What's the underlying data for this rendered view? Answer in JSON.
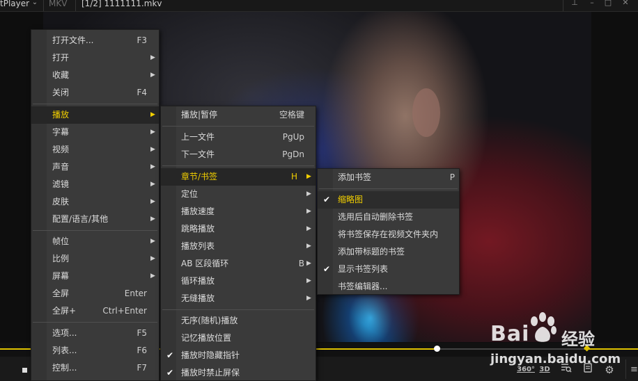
{
  "titlebar": {
    "app_name": "tPlayer",
    "format": "MKV",
    "file": "[1/2] 1111111.mkv"
  },
  "icons": {
    "app_menu": "chevron-down",
    "pin": "pin",
    "minimize": "minimize",
    "maximize": "maximize",
    "close": "close",
    "stop": "stop",
    "vr360": "360",
    "view3d": "3D",
    "playlist_search": "playlist-search",
    "notes": "notes",
    "settings": "gear",
    "menu": "hamburger"
  },
  "controls": {
    "btn_360": "360°",
    "btn_3d": "3D"
  },
  "progress": {
    "position_fraction": 0.684
  },
  "menu_main": {
    "items": [
      {
        "label": "打开文件...",
        "shortcut": "F3"
      },
      {
        "label": "打开",
        "arrow": "▶"
      },
      {
        "label": "收藏",
        "arrow": "▶"
      },
      {
        "label": "关闭",
        "shortcut": "F4"
      },
      {
        "label": "播放",
        "arrow": "▶"
      },
      {
        "label": "字幕",
        "arrow": "▶"
      },
      {
        "label": "视频",
        "arrow": "▶"
      },
      {
        "label": "声音",
        "arrow": "▶"
      },
      {
        "label": "滤镜",
        "arrow": "▶"
      },
      {
        "label": "皮肤",
        "arrow": "▶"
      },
      {
        "label": "配置/语言/其他",
        "arrow": "▶"
      },
      {
        "label": "帧位",
        "arrow": "▶"
      },
      {
        "label": "比例",
        "arrow": "▶"
      },
      {
        "label": "屏幕",
        "arrow": "▶"
      },
      {
        "label": "全屏",
        "shortcut": "Enter"
      },
      {
        "label": "全屏+",
        "shortcut": "Ctrl+Enter"
      },
      {
        "label": "选项...",
        "shortcut": "F5"
      },
      {
        "label": "列表...",
        "shortcut": "F6"
      },
      {
        "label": "控制...",
        "shortcut": "F7"
      }
    ]
  },
  "menu_play": {
    "items": [
      {
        "label": "播放|暂停",
        "shortcut": "空格键"
      },
      {
        "label": "上一文件",
        "shortcut": "PgUp"
      },
      {
        "label": "下一文件",
        "shortcut": "PgDn"
      },
      {
        "label": "章节/书签",
        "shortcut": "H",
        "arrow": "▶"
      },
      {
        "label": "定位",
        "arrow": "▶"
      },
      {
        "label": "播放速度",
        "arrow": "▶"
      },
      {
        "label": "跳略播放",
        "arrow": "▶"
      },
      {
        "label": "播放列表",
        "arrow": "▶"
      },
      {
        "label": "AB 区段循环",
        "shortcut": "B",
        "arrow": "▶"
      },
      {
        "label": "循环播放",
        "arrow": "▶"
      },
      {
        "label": "无缝播放",
        "arrow": "▶"
      },
      {
        "label": "无序(随机)播放"
      },
      {
        "label": "记忆播放位置"
      },
      {
        "label": "播放时隐藏指针",
        "check": "✔"
      },
      {
        "label": "播放时禁止屏保",
        "check": "✔"
      }
    ]
  },
  "menu_bookmark": {
    "items": [
      {
        "label": "添加书签",
        "shortcut": "P"
      },
      {
        "label": "缩略图",
        "check": "✔"
      },
      {
        "label": "选用后自动删除书签"
      },
      {
        "label": "将书签保存在视频文件夹内"
      },
      {
        "label": "添加带标题的书签"
      },
      {
        "label": "显示书签列表",
        "check": "✔"
      },
      {
        "label": "书签编辑器..."
      }
    ]
  },
  "watermark": {
    "brand": "Bai",
    "cn": "经验",
    "url": "jingyan.baidu.com"
  }
}
